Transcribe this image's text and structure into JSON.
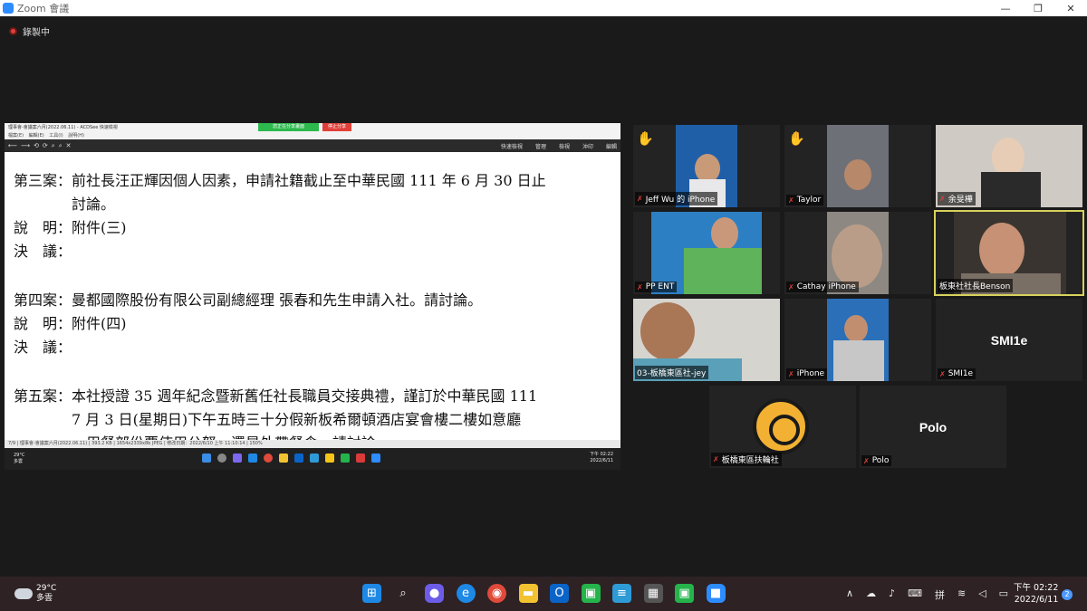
{
  "window": {
    "title": "Zoom 會議",
    "min": "—",
    "restore": "❐",
    "close": "✕"
  },
  "recording": "錄製中",
  "share": {
    "app_title": "理事會-會議案六月(2022.06.11) - ACDSee 快速檢視",
    "share_label": "您正在分享畫面",
    "stop_label": "停止分享",
    "menu": "檔案(E) 編輯(E) 工具(I) 說明(H)",
    "toolbar_tools": "⟵⟶⟲⟳⌕⌕✕",
    "tabs": [
      "快速檢視",
      "管理",
      "檢視",
      "沖印",
      "編輯"
    ],
    "doc_lines": [
      "第三案：前社長汪正輝因個人因素，申請社籍截止至中華民國 111 年 6 月 30 日止",
      "　　　　討論。",
      "說　明：附件(三)",
      "決　議：",
      "第四案：曼都國際股份有限公司副總經理 張春和先生申請入社。請討論。",
      "說　明：附件(四)",
      "決　議：",
      "第五案：本社授證 35 週年紀念暨新舊任社長職員交接典禮，謹訂於中華民國 111",
      "　　　　7 月 3 日(星期日)下午五時三十分假新板希爾頓酒店宴會樓二樓如意廳",
      "　　　　，用餐部份要使用公帑，還是外帶餐食。請討論。"
    ],
    "status": "7/9 | 理事會-會議案六月(2022.06.11) | 393.2 KB | 1654x2339x8b JPEG | 修改日期：2022/6/10 上午 11:10:14 | 150%",
    "inner_weather": [
      "29°C",
      "多雲"
    ],
    "inner_clock": [
      "下午 02:22",
      "2022/6/11"
    ]
  },
  "participants": [
    {
      "name": "Jeff Wu 的 iPhone",
      "hand": true
    },
    {
      "name": "Taylor",
      "hand": true
    },
    {
      "name": "余旻樺"
    },
    {
      "name": "PP ENT"
    },
    {
      "name": "Cathay iPhone"
    },
    {
      "name": "板東社社長Benson",
      "active": true
    },
    {
      "name": "03-板橋東區社-jey"
    },
    {
      "name": "iPhone"
    },
    {
      "name": "SMI1e",
      "big": "SMI1e"
    },
    {
      "name": "板橋東區扶輪社"
    },
    {
      "name": "Polo",
      "big": "Polo"
    }
  ],
  "icons": {
    "hand": "✋",
    "mic_muted": "✗",
    "chart_sign": "板橋東區扶輪社"
  },
  "taskbar": {
    "weather_temp": "29°C",
    "weather_desc": "多雲",
    "clock_time": "下午 02:22",
    "clock_date": "2022/6/11",
    "notification_count": "2"
  },
  "colors": {
    "accent": "#2d8cff",
    "active_speaker": "#d7d25c",
    "muted": "#e0403a"
  }
}
